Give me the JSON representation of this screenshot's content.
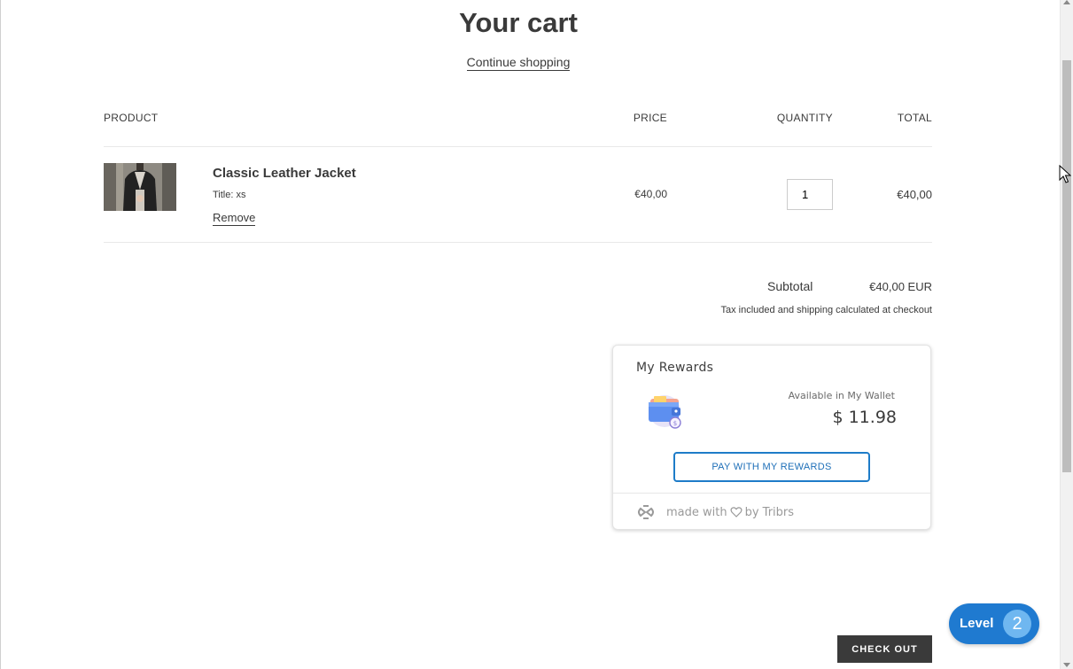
{
  "page": {
    "title": "Your cart",
    "continue_link": "Continue shopping"
  },
  "table": {
    "headers": {
      "product": "PRODUCT",
      "price": "PRICE",
      "quantity": "QUANTITY",
      "total": "TOTAL"
    },
    "rows": [
      {
        "name": "Classic Leather Jacket",
        "variant": "Title: xs",
        "remove_label": "Remove",
        "price": "€40,00",
        "quantity": "1",
        "total": "€40,00"
      }
    ]
  },
  "summary": {
    "subtotal_label": "Subtotal",
    "subtotal_value": "€40,00 EUR",
    "tax_note": "Tax included and shipping calculated at checkout"
  },
  "rewards": {
    "title": "My Rewards",
    "available_label": "Available in My Wallet",
    "amount": "$ 11.98",
    "pay_button": "PAY WITH MY REWARDS",
    "footer_made": "made with",
    "footer_by": "by Tribrs",
    "accent_color": "#1e7cc8"
  },
  "level_widget": {
    "label": "Level",
    "value": "2",
    "color": "#1f7ad0"
  },
  "checkout": {
    "label": "CHECK OUT"
  },
  "icons": {
    "wallet": "wallet-icon",
    "tribrs_logo": "tribrs-logo-icon",
    "heart": "heart-icon",
    "cursor": "mouse-cursor-icon"
  }
}
